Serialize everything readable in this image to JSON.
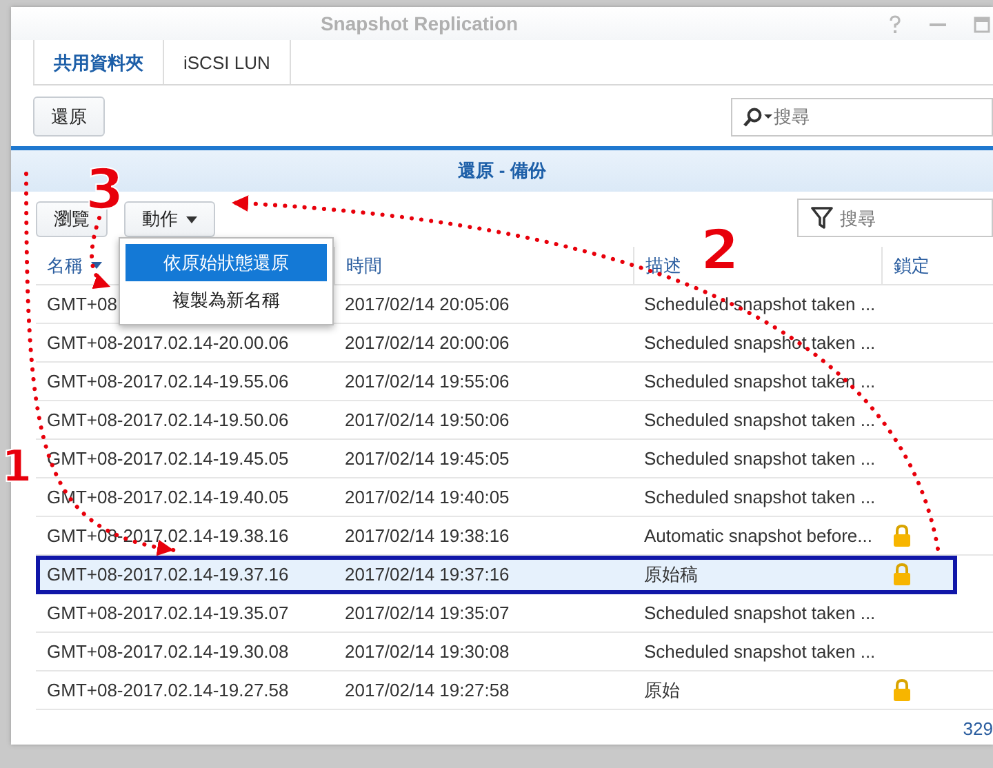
{
  "window": {
    "title": "Snapshot Replication"
  },
  "tabs": [
    {
      "label": "共用資料夾",
      "selected": true
    },
    {
      "label": "iSCSI LUN",
      "selected": false
    }
  ],
  "toolbar": {
    "restore_button": "還原",
    "search": {
      "placeholder": "搜尋"
    }
  },
  "panel": {
    "title": "還原 - 備份",
    "buttons": [
      {
        "label": "瀏覽",
        "kind": "plain"
      },
      {
        "label": "動作",
        "kind": "dropdown"
      }
    ],
    "filter": {
      "placeholder": "搜尋"
    }
  },
  "menu": [
    {
      "label": "依原始狀態還原",
      "selected": true
    },
    {
      "label": "複製為新名稱",
      "selected": false
    }
  ],
  "table": {
    "columns": [
      "名稱",
      "時間",
      "描述",
      "鎖定"
    ],
    "rows": [
      {
        "name": "GMT+08",
        "time": "2017/02/14 20:05:06",
        "description": "Scheduled snapshot taken ...",
        "locked": false,
        "selected": false
      },
      {
        "name": "GMT+08-2017.02.14-20.00.06",
        "time": "2017/02/14 20:00:06",
        "description": "Scheduled snapshot taken ...",
        "locked": false,
        "selected": false
      },
      {
        "name": "GMT+08-2017.02.14-19.55.06",
        "time": "2017/02/14 19:55:06",
        "description": "Scheduled snapshot taken ...",
        "locked": false,
        "selected": false
      },
      {
        "name": "GMT+08-2017.02.14-19.50.06",
        "time": "2017/02/14 19:50:06",
        "description": "Scheduled snapshot taken ...",
        "locked": false,
        "selected": false
      },
      {
        "name": "GMT+08-2017.02.14-19.45.05",
        "time": "2017/02/14 19:45:05",
        "description": "Scheduled snapshot taken ...",
        "locked": false,
        "selected": false
      },
      {
        "name": "GMT+08-2017.02.14-19.40.05",
        "time": "2017/02/14 19:40:05",
        "description": "Scheduled snapshot taken ...",
        "locked": false,
        "selected": false
      },
      {
        "name": "GMT+08-2017.02.14-19.38.16",
        "time": "2017/02/14 19:38:16",
        "description": "Automatic snapshot before...",
        "locked": true,
        "selected": false
      },
      {
        "name": "GMT+08-2017.02.14-19.37.16",
        "time": "2017/02/14 19:37:16",
        "description": "原始稿",
        "locked": true,
        "selected": true
      },
      {
        "name": "GMT+08-2017.02.14-19.35.07",
        "time": "2017/02/14 19:35:07",
        "description": "Scheduled snapshot taken ...",
        "locked": false,
        "selected": false
      },
      {
        "name": "GMT+08-2017.02.14-19.30.08",
        "time": "2017/02/14 19:30:08",
        "description": "Scheduled snapshot taken ...",
        "locked": false,
        "selected": false
      },
      {
        "name": "GMT+08-2017.02.14-19.27.58",
        "time": "2017/02/14 19:27:58",
        "description": "原始",
        "locked": true,
        "selected": false
      }
    ]
  },
  "footer": "329",
  "annotations": [
    {
      "label": "1"
    },
    {
      "label": "2"
    },
    {
      "label": "3"
    }
  ]
}
